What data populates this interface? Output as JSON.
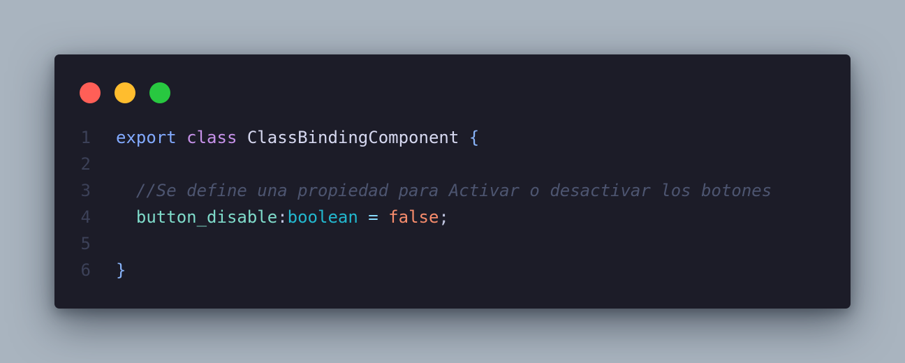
{
  "window_controls": {
    "close_color": "#ff5f57",
    "minimize_color": "#ffbd2e",
    "maximize_color": "#28c840"
  },
  "editor": {
    "background": "#1c1c28",
    "lines": [
      {
        "number": "1",
        "tokens": [
          {
            "text": "export",
            "kind": "keyword",
            "color": "#82aaff"
          },
          {
            "text": " ",
            "kind": "space",
            "color": "#c0c5e0"
          },
          {
            "text": "class",
            "kind": "storage",
            "color": "#c792ea"
          },
          {
            "text": " ",
            "kind": "space",
            "color": "#c0c5e0"
          },
          {
            "text": "ClassBindingComponent",
            "kind": "class-name",
            "color": "#d6d8f0"
          },
          {
            "text": " ",
            "kind": "space",
            "color": "#c0c5e0"
          },
          {
            "text": "{",
            "kind": "brace",
            "color": "#89b4fa"
          }
        ]
      },
      {
        "number": "2",
        "tokens": []
      },
      {
        "number": "3",
        "tokens": [
          {
            "text": "  ",
            "kind": "space",
            "color": "#c0c5e0"
          },
          {
            "text": "//Se define una propiedad para Activar o desactivar los botones",
            "kind": "comment",
            "color": "#4d5570"
          }
        ]
      },
      {
        "number": "4",
        "tokens": [
          {
            "text": "  ",
            "kind": "space",
            "color": "#c0c5e0"
          },
          {
            "text": "button_disable",
            "kind": "property",
            "color": "#7fdbca"
          },
          {
            "text": ":",
            "kind": "punctuation",
            "color": "#c0c5e0"
          },
          {
            "text": "boolean",
            "kind": "type",
            "color": "#22b8cf"
          },
          {
            "text": " ",
            "kind": "space",
            "color": "#c0c5e0"
          },
          {
            "text": "=",
            "kind": "operator",
            "color": "#89ddff"
          },
          {
            "text": " ",
            "kind": "space",
            "color": "#c0c5e0"
          },
          {
            "text": "false",
            "kind": "literal",
            "color": "#f78c6c"
          },
          {
            "text": ";",
            "kind": "punctuation",
            "color": "#c0c5e0"
          }
        ]
      },
      {
        "number": "5",
        "tokens": []
      },
      {
        "number": "6",
        "tokens": [
          {
            "text": "}",
            "kind": "brace",
            "color": "#89b4fa"
          }
        ]
      }
    ]
  }
}
